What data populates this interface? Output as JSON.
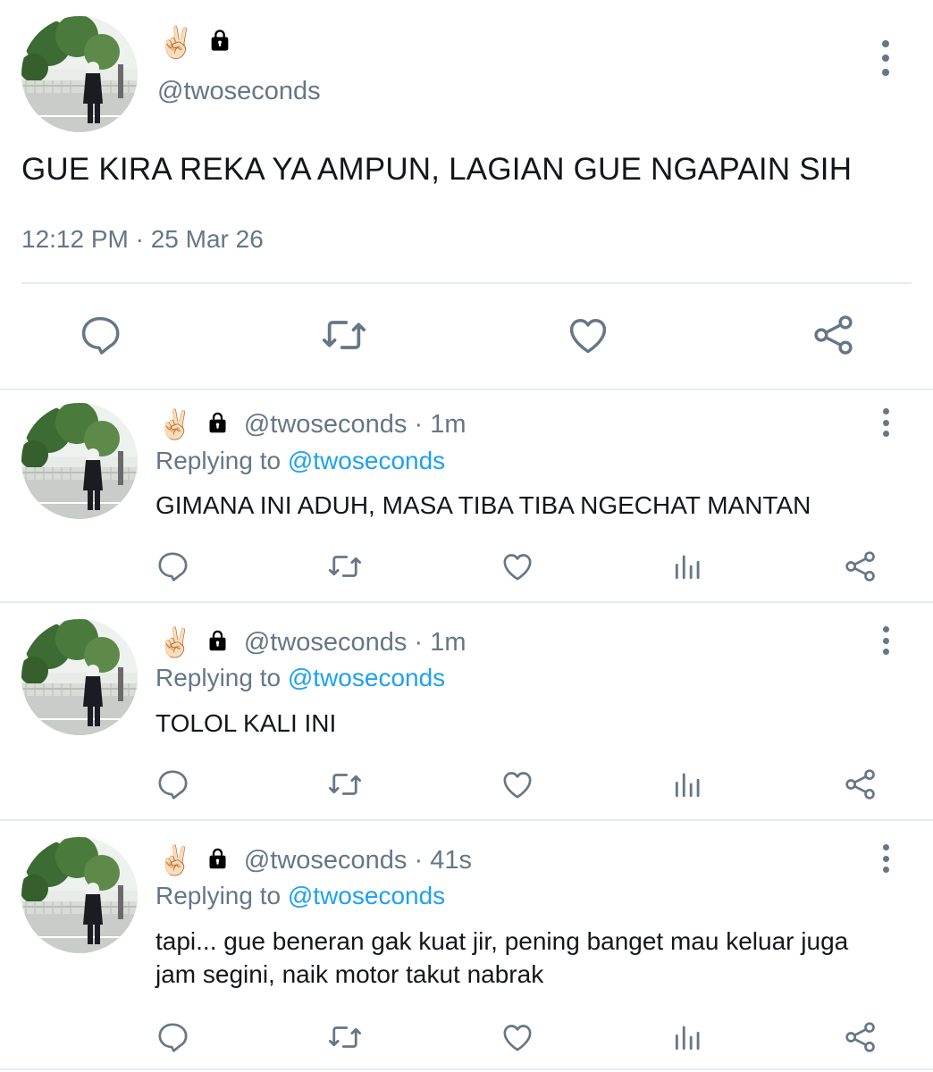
{
  "colors": {
    "text": "#14171a",
    "secondary": "#657786",
    "link": "#1da1f2",
    "divider": "#e6ecf0"
  },
  "main_tweet": {
    "emoji": "✌🏻",
    "lock_icon": "lock-icon",
    "handle": "@twoseconds",
    "text": "GUE KIRA REKA YA AMPUN, LAGIAN GUE NGAPAIN SIH",
    "timestamp": "12:12 PM · 25 Mar 26",
    "actions": [
      "reply-icon",
      "retweet-icon",
      "like-icon",
      "share-icon"
    ]
  },
  "replies": [
    {
      "emoji": "✌🏻",
      "handle_time": "@twoseconds · 1m",
      "replying_prefix": "Replying to",
      "replying_to": "@twoseconds",
      "text": "GIMANA INI ADUH, MASA TIBA TIBA NGECHAT MANTAN"
    },
    {
      "emoji": "✌🏻",
      "handle_time": "@twoseconds · 1m",
      "replying_prefix": "Replying to",
      "replying_to": "@twoseconds",
      "text": "TOLOL KALI INI"
    },
    {
      "emoji": "✌🏻",
      "handle_time": "@twoseconds · 41s",
      "replying_prefix": "Replying to",
      "replying_to": "@twoseconds",
      "text": "tapi... gue beneran gak kuat jir, pening banget mau keluar juga jam segini, naik motor takut nabrak"
    }
  ]
}
